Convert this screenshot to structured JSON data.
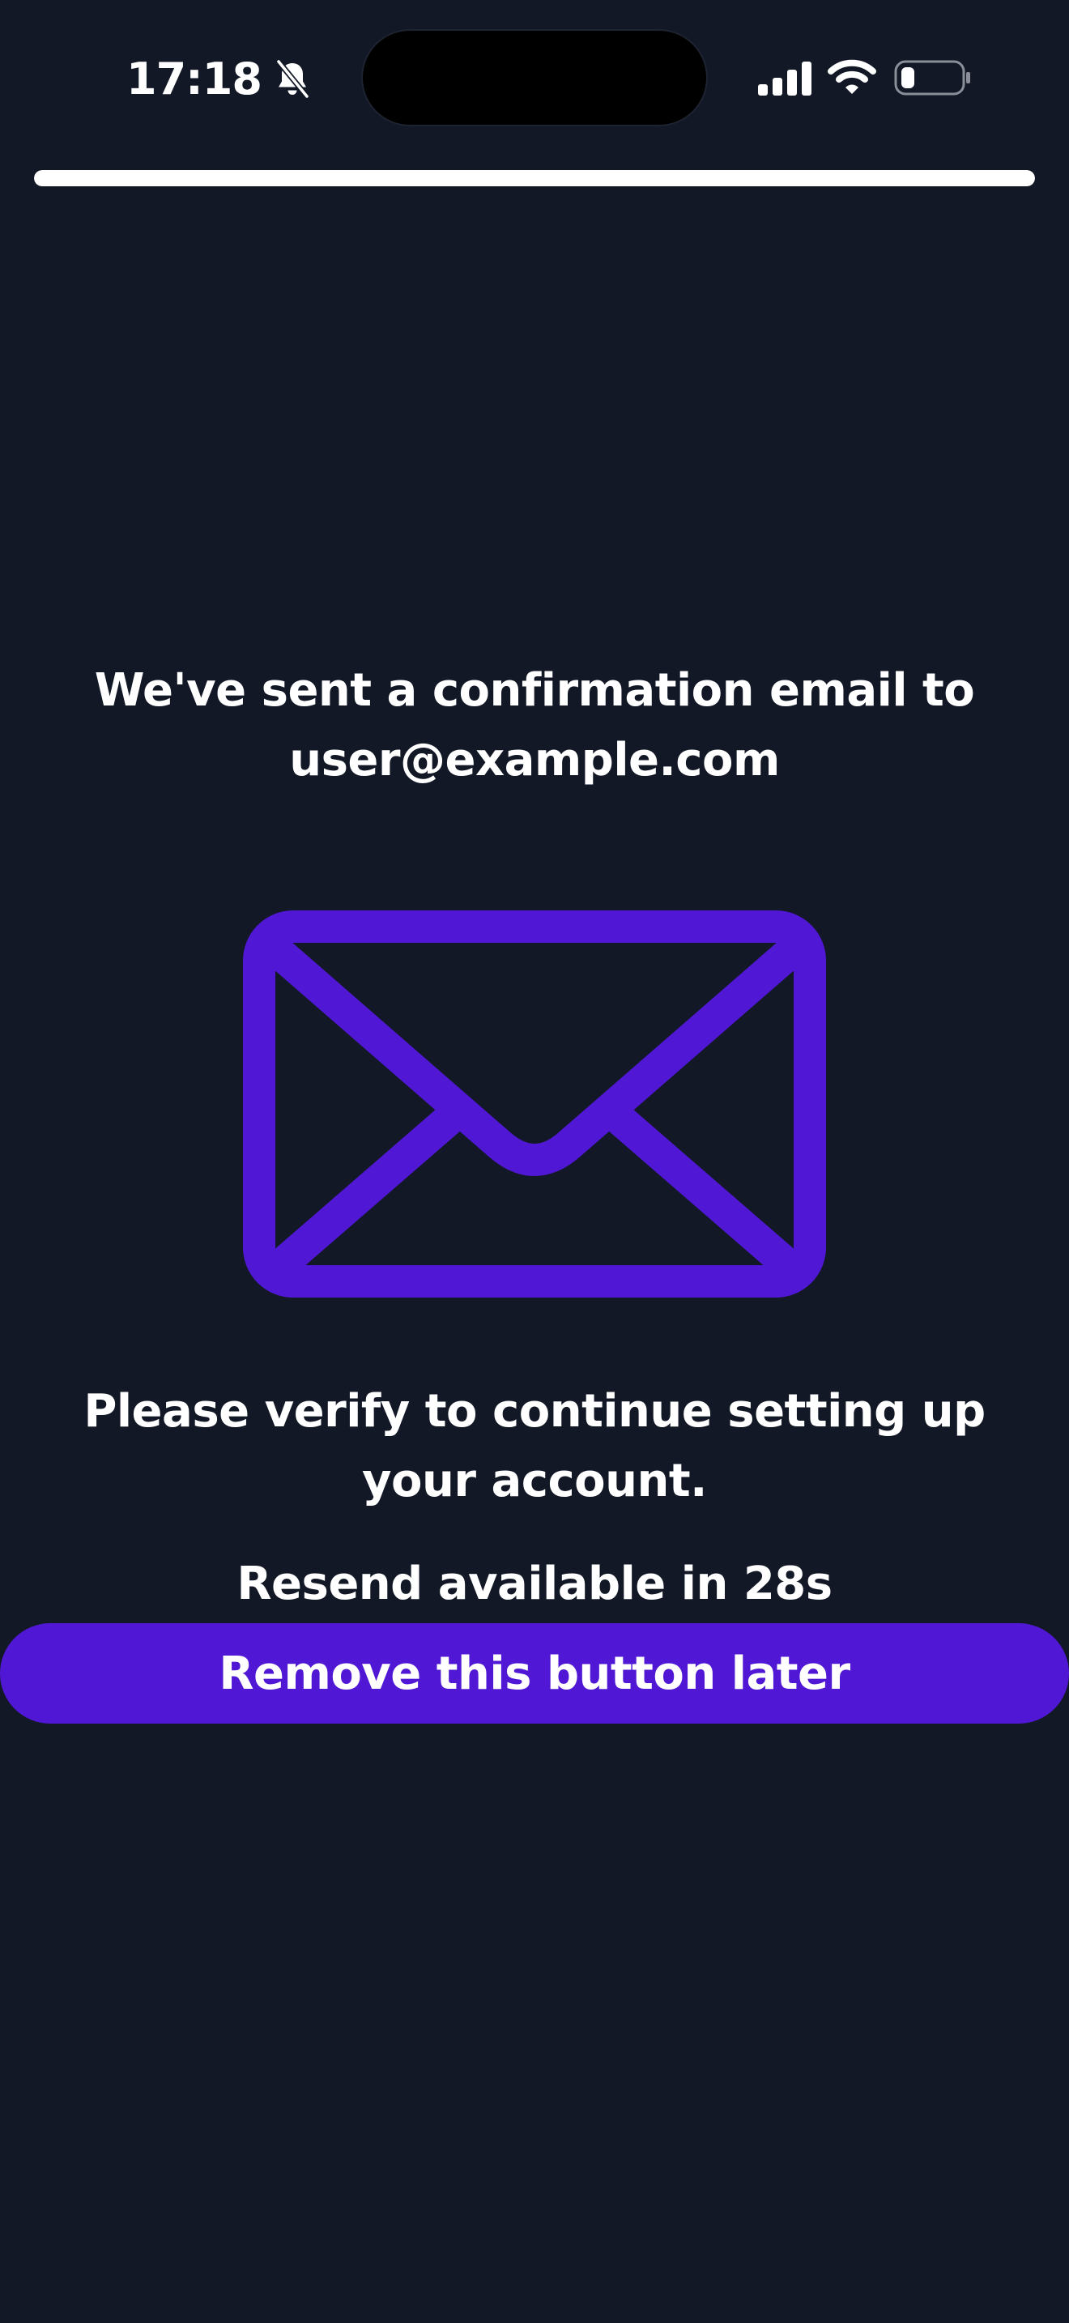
{
  "status_bar": {
    "time": "17:18",
    "icons": [
      "bell-slash-icon",
      "cellular-signal-icon",
      "wifi-icon",
      "battery-low-icon"
    ],
    "battery_level": 0.2
  },
  "progress": {
    "value": 1.0
  },
  "content": {
    "headline": "We've sent a confirmation email to user@example.com",
    "icon": "envelope-icon",
    "instruction": "Please verify to continue setting up your account.",
    "resend_text": "Resend available in 28s"
  },
  "button": {
    "label": "Remove this button later"
  },
  "colors": {
    "background": "#121826",
    "accent": "#5018d4",
    "text": "#ffffff"
  }
}
